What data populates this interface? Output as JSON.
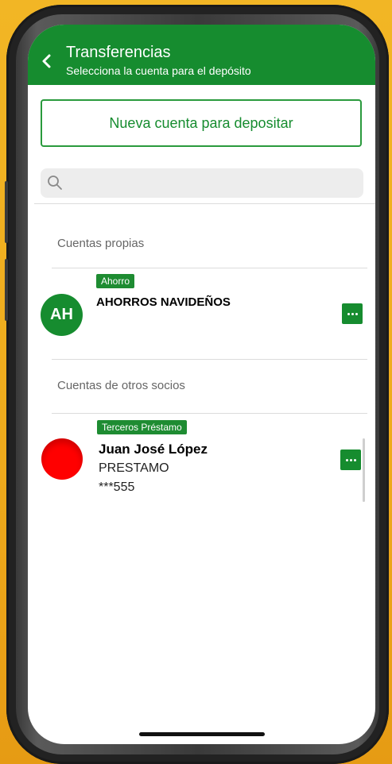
{
  "header": {
    "title": "Transferencias",
    "subtitle": "Selecciona la cuenta para el depósito"
  },
  "actions": {
    "new_account_label": "Nueva cuenta para depositar"
  },
  "search": {
    "placeholder": "",
    "value": ""
  },
  "sections": {
    "own_accounts_label": "Cuentas propias",
    "other_accounts_label": "Cuentas de otros socios"
  },
  "own_accounts": [
    {
      "tag": "Ahorro",
      "avatar_initials": "AH",
      "name": "AHORROS NAVIDEÑOS",
      "avatar_color": "#168c2f"
    }
  ],
  "other_accounts": [
    {
      "tag": "Terceros Préstamo",
      "name": "Juan José López",
      "type": "PRESTAMO",
      "number": "***555",
      "avatar_color": "#ff0000"
    }
  ],
  "icons": {
    "back": "chevron-left-icon",
    "search": "search-icon",
    "more": "more-horizontal-icon"
  },
  "colors": {
    "primary": "#168c2f",
    "background": "#ffffff",
    "frame_bg": "#f2b625"
  }
}
